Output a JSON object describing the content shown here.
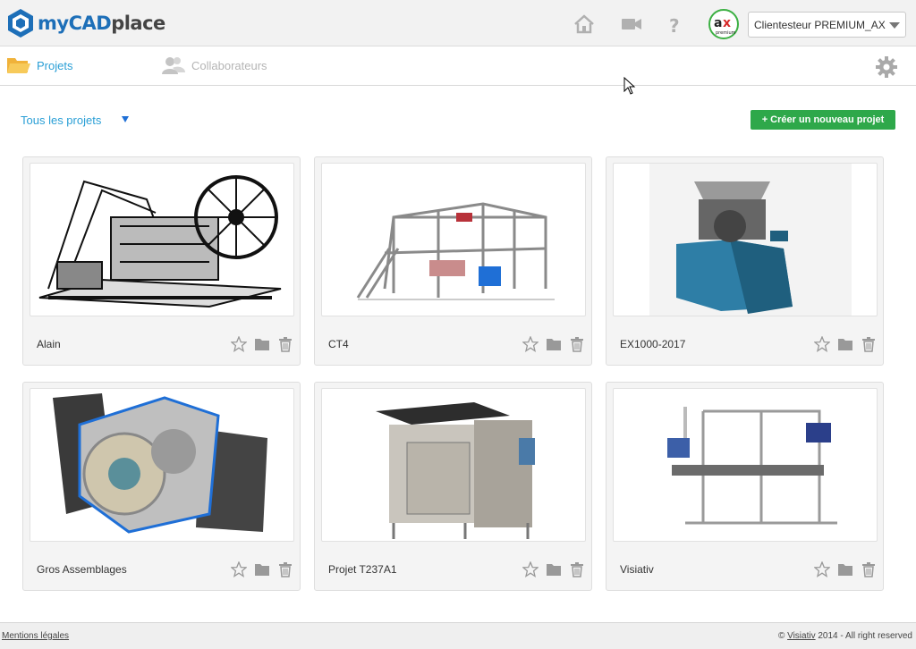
{
  "app": {
    "logo": {
      "my": "my",
      "cad": "CAD",
      "place": "place"
    },
    "account": "Clientesteur PREMIUM_AX",
    "ax_badge_text": "premium",
    "accent_color": "#2a9fd6",
    "brand_color": "#1d6fb8"
  },
  "header_icons": [
    "home-icon",
    "video-camera-icon",
    "help-icon"
  ],
  "nav": {
    "projets": "Projets",
    "collaborateurs": "Collaborateurs"
  },
  "filter": {
    "label": "Tous les projets",
    "new_button": "+ Créer un nouveau projet",
    "button_color": "#2ea84a"
  },
  "projects": [
    {
      "name": "Alain"
    },
    {
      "name": "CT4"
    },
    {
      "name": "EX1000-2017"
    },
    {
      "name": "Gros Assemblages"
    },
    {
      "name": "Projet T237A1"
    },
    {
      "name": "Visiativ"
    }
  ],
  "footer": {
    "left": "Mentions légales",
    "copyright": "©",
    "brand": "Visiativ",
    "rights": "2014 - All right reserved"
  }
}
